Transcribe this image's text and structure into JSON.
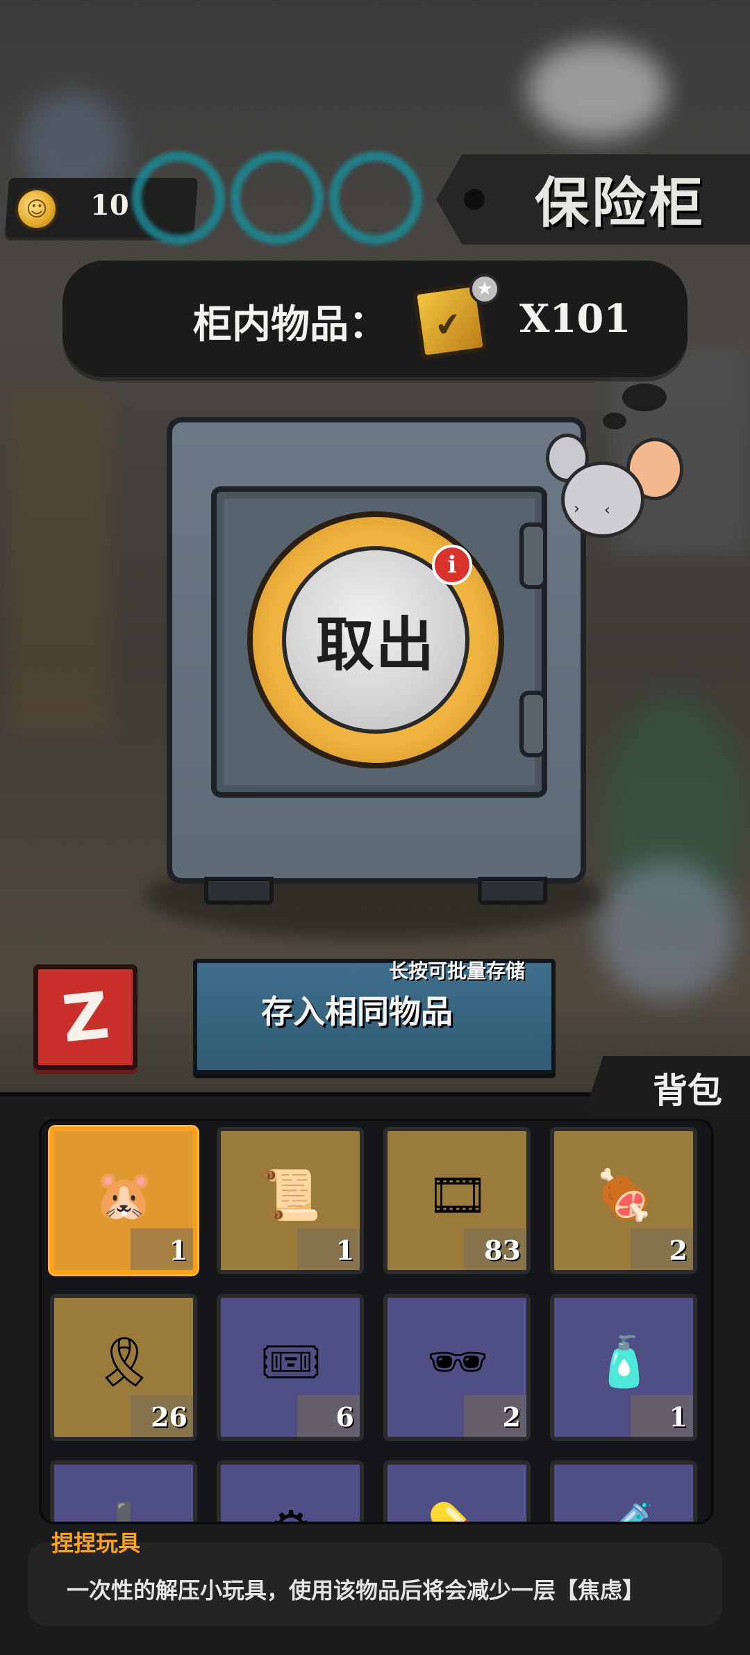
{
  "top": {
    "coin_count": "10",
    "coin_icon": "gold-coin-icon",
    "title": "保险柜"
  },
  "safe": {
    "items_label": "柜内物品：",
    "items_icon": "gold-card-icon",
    "items_count": "X101",
    "withdraw_label": "取出",
    "info_badge": "i"
  },
  "actions": {
    "red_button_icon": "Z",
    "store_hint": "长按可批量存储",
    "store_label": "存入相同物品"
  },
  "backpack": {
    "title": "背包",
    "slots": [
      {
        "icon": "capybara-toy-pack-icon",
        "count": "1",
        "color": "brown",
        "selected": true
      },
      {
        "icon": "crumpled-paper-icon",
        "count": "1",
        "color": "brown"
      },
      {
        "icon": "film-reel-icon",
        "count": "83",
        "color": "brown"
      },
      {
        "icon": "steak-meal-icon",
        "count": "2",
        "color": "brown"
      },
      {
        "icon": "gold-ribbon-card-icon",
        "count": "26",
        "color": "brown"
      },
      {
        "icon": "toy-ticket-icon",
        "count": "6",
        "color": "purple"
      },
      {
        "icon": "sunglasses-card-icon",
        "count": "2",
        "color": "purple"
      },
      {
        "icon": "hot-sauce-bottle-icon",
        "count": "1",
        "color": "purple"
      },
      {
        "icon": "first-aid-kit-icon",
        "count": "",
        "color": "purple"
      },
      {
        "icon": "gear-package-icon",
        "count": "",
        "color": "purple"
      },
      {
        "icon": "medicine-box-icon",
        "count": "",
        "color": "purple"
      },
      {
        "icon": "pill-bottle-icon",
        "count": "",
        "color": "purple"
      }
    ]
  },
  "description": {
    "title": "捏捏玩具",
    "text": "一次性的解压小玩具，使用该物品后将会减少一层【焦虑】"
  }
}
